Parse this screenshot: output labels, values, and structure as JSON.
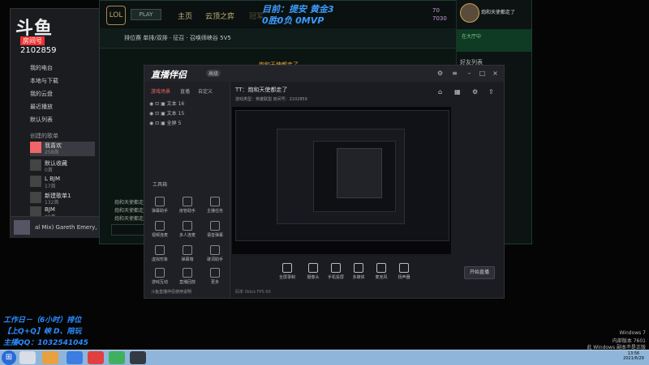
{
  "music": {
    "brand": "斗鱼",
    "room_label": "房间号",
    "room_no": "2102859",
    "nav": [
      "我的电台",
      "本地与下载",
      "我的云盘",
      "最近播放",
      "默认列表"
    ],
    "section": "创建的歌单",
    "playlists": [
      {
        "name": "我喜欢",
        "count": "258首"
      },
      {
        "name": "默认收藏",
        "count": "0首"
      },
      {
        "name": "L BJM",
        "count": "17首"
      },
      {
        "name": "新建歌单1",
        "count": "132首"
      },
      {
        "name": "BJM",
        "count": "89首"
      }
    ],
    "track": "al Mix) Gareth Emery, Way"
  },
  "game": {
    "logo": "LOL",
    "play": "PLAY",
    "tabs": [
      "主页",
      "云顶之弈",
      "冠军"
    ],
    "banner_line1": "目前：提安  黄金3",
    "banner_line2": "0胜0负 0MVP",
    "stats": [
      "70",
      "7030"
    ],
    "crumb": "排位赛 单排/双排 · 征召 · 召唤师峡谷 5V5",
    "notice": "炮和天使都走了",
    "chat": [
      "炮和天使都走了",
      "炮和天使都走了",
      "炮和天使都走了"
    ]
  },
  "social": {
    "username": "炮和天使都走了",
    "green": "在大厅中",
    "friends": "好友列表",
    "online": "在线"
  },
  "stream": {
    "brand": "直播伴侣",
    "badge": "高级",
    "tabs": [
      "游戏场景",
      "直播",
      "自定义"
    ],
    "sources": [
      "文本 16",
      "文本 15",
      "全屏 5"
    ],
    "tools_header": "工具箱",
    "tools": [
      "弹幕助手",
      "房管助手",
      "主播任务",
      "视频连麦",
      "多人连麦",
      "语音弹幕",
      "虚拟形象",
      "弹幕墙",
      "歌词助手",
      "游戏互动",
      "直播回放",
      "更多"
    ],
    "foot": "斗鱼直播伴侣使用说明",
    "title": "TT：炮和天使都走了",
    "row": "游戏类型：英雄联盟   房间号：2102859",
    "bottom_tools": [
      "全屏录制",
      "摄像头",
      "手机投屏",
      "多媒体",
      "麦克风",
      "扬声器"
    ],
    "start": "开始直播",
    "status": "码率 0kb/s   FPS 60"
  },
  "overlay": {
    "line1": "工作日－（6小时）排位",
    "line2": "【上Q+Q】峡 D、陪玩",
    "line3": "主播QQ：1032541045"
  },
  "watermark": {
    "l1": "Windows 7",
    "l2": "内部版本 7601",
    "l3": "此 Windows 副本不是正版"
  },
  "clock": {
    "time": "13:56",
    "date": "2021/6/29"
  }
}
